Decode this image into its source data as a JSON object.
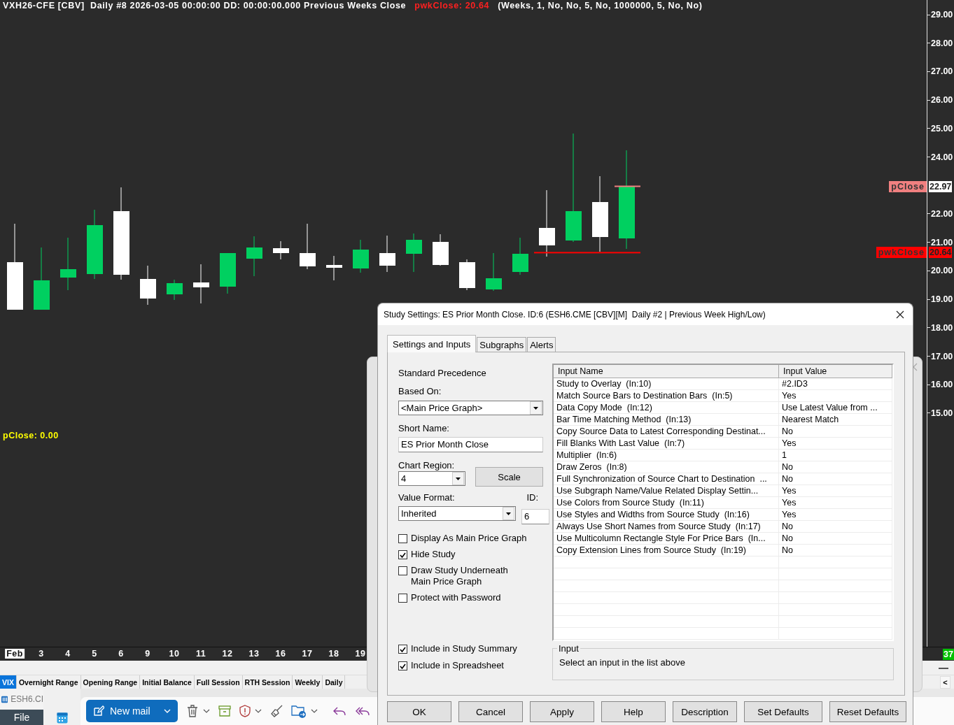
{
  "chart": {
    "header": {
      "title": "VXH26-CFE [CBV]  Daily #8 2026-03-05 00:00:00 DD: 00:00:00.000 Previous Weeks Close",
      "study_value": "pwkClose: 20.64",
      "parameters": "(Weeks, 1, No, No, 5, No, 1000000, 5, No, No)"
    },
    "y_ticks": [
      "29.00",
      "28.00",
      "27.00",
      "26.00",
      "25.00",
      "24.00",
      "22.00",
      "21.00",
      "20.00",
      "19.00",
      "18.00",
      "17.00",
      "16.00",
      "15.00"
    ],
    "markers": [
      {
        "name": "pClose",
        "value": "22.97",
        "kind": "daily",
        "color": "#f08080",
        "value_filled": false
      },
      {
        "name": "pwkClose",
        "value": "20.64",
        "kind": "weekly",
        "color": "#ff0000",
        "value_filled": true
      }
    ],
    "overlay_label": "pClose: 0.00",
    "x_labels": [
      {
        "label": "Feb",
        "kind": "month"
      },
      {
        "label": "3",
        "kind": "day"
      },
      {
        "label": "4",
        "kind": "day"
      },
      {
        "label": "5",
        "kind": "day"
      },
      {
        "label": "6",
        "kind": "day"
      },
      {
        "label": "9",
        "kind": "day"
      },
      {
        "label": "10",
        "kind": "day"
      },
      {
        "label": "11",
        "kind": "day"
      },
      {
        "label": "12",
        "kind": "day"
      },
      {
        "label": "13",
        "kind": "day"
      },
      {
        "label": "16",
        "kind": "day"
      },
      {
        "label": "17",
        "kind": "day"
      },
      {
        "label": "18",
        "kind": "day"
      },
      {
        "label": "19",
        "kind": "day"
      }
    ],
    "bar_count": "37"
  },
  "chartbook_tabs": [
    {
      "label": "VIX",
      "selected": true
    },
    {
      "label": "Overnight Range",
      "selected": false
    },
    {
      "label": "Opening Range",
      "selected": false
    },
    {
      "label": "Initial Balance",
      "selected": false
    },
    {
      "label": "Full Session",
      "selected": false
    },
    {
      "label": "RTH Session",
      "selected": false
    },
    {
      "label": "Weekly",
      "selected": false
    },
    {
      "label": "Daily",
      "selected": false
    }
  ],
  "scroll_button": "<",
  "taskbar": {
    "chart_item": "ESH6.CI",
    "file_menu": "File",
    "new_mail": "New mail"
  },
  "dialog": {
    "title": "Study Settings: ES Prior Month Close. ID:6 (ESH6.CME [CBV][M]  Daily #2 | Previous Week High/Low)",
    "tabs": [
      {
        "label": "Settings and Inputs",
        "selected": true
      },
      {
        "label": "Subgraphs",
        "selected": false
      },
      {
        "label": "Alerts",
        "selected": false
      }
    ],
    "precedence": "Standard Precedence",
    "based_on": {
      "label": "Based On:",
      "value": "<Main Price Graph>"
    },
    "short_name": {
      "label": "Short Name:",
      "value": "ES Prior Month Close"
    },
    "chart_region": {
      "label": "Chart Region:",
      "value": "4",
      "button": "Scale"
    },
    "value_format": {
      "label": "Value Format:",
      "value": "Inherited"
    },
    "id": {
      "label": "ID:",
      "value": "6"
    },
    "options": [
      {
        "label": "Display As Main Price Graph",
        "checked": false
      },
      {
        "label": "Hide Study",
        "checked": true
      },
      {
        "label": "Draw Study Underneath Main Price Graph",
        "checked": false
      },
      {
        "label": "Protect with Password",
        "checked": false
      }
    ],
    "summary_options": [
      {
        "label": "Include in Study Summary",
        "checked": true
      },
      {
        "label": "Include in Spreadsheet",
        "checked": true
      }
    ],
    "table": {
      "columns": [
        "Input Name",
        "Input Value"
      ],
      "rows": [
        [
          "Study to Overlay  (In:10)",
          "#2.ID3"
        ],
        [
          "Match Source Bars to Destination Bars  (In:5)",
          "Yes"
        ],
        [
          "Data Copy Mode  (In:12)",
          "Use Latest Value from ..."
        ],
        [
          "Bar Time Matching Method  (In:13)",
          "Nearest Match"
        ],
        [
          "Copy Source Data to Latest Corresponding Destinat...",
          "No"
        ],
        [
          "Fill Blanks With Last Value  (In:7)",
          "Yes"
        ],
        [
          "Multiplier  (In:6)",
          "1"
        ],
        [
          "Draw Zeros  (In:8)",
          "No"
        ],
        [
          "Full Synchronization of Source Chart to Destination  ...",
          "No"
        ],
        [
          "Use Subgraph Name/Value Related Display Settin...",
          "Yes"
        ],
        [
          "Use Colors from Source Study  (In:11)",
          "Yes"
        ],
        [
          "Use Styles and Widths from Source Study  (In:16)",
          "Yes"
        ],
        [
          "Always Use Short Names from Source Study  (In:17)",
          "No"
        ],
        [
          "Use Multicolumn Rectangle Style For Price Bars  (In...",
          "No"
        ],
        [
          "Copy Extension Lines from Source Study  (In:19)",
          "No"
        ]
      ]
    },
    "input_group": {
      "legend": "Input",
      "text": "Select an input in the list above"
    },
    "buttons": [
      "OK",
      "Cancel",
      "Apply",
      "Help",
      "Description",
      "Set Defaults",
      "Reset Defaults"
    ]
  }
}
